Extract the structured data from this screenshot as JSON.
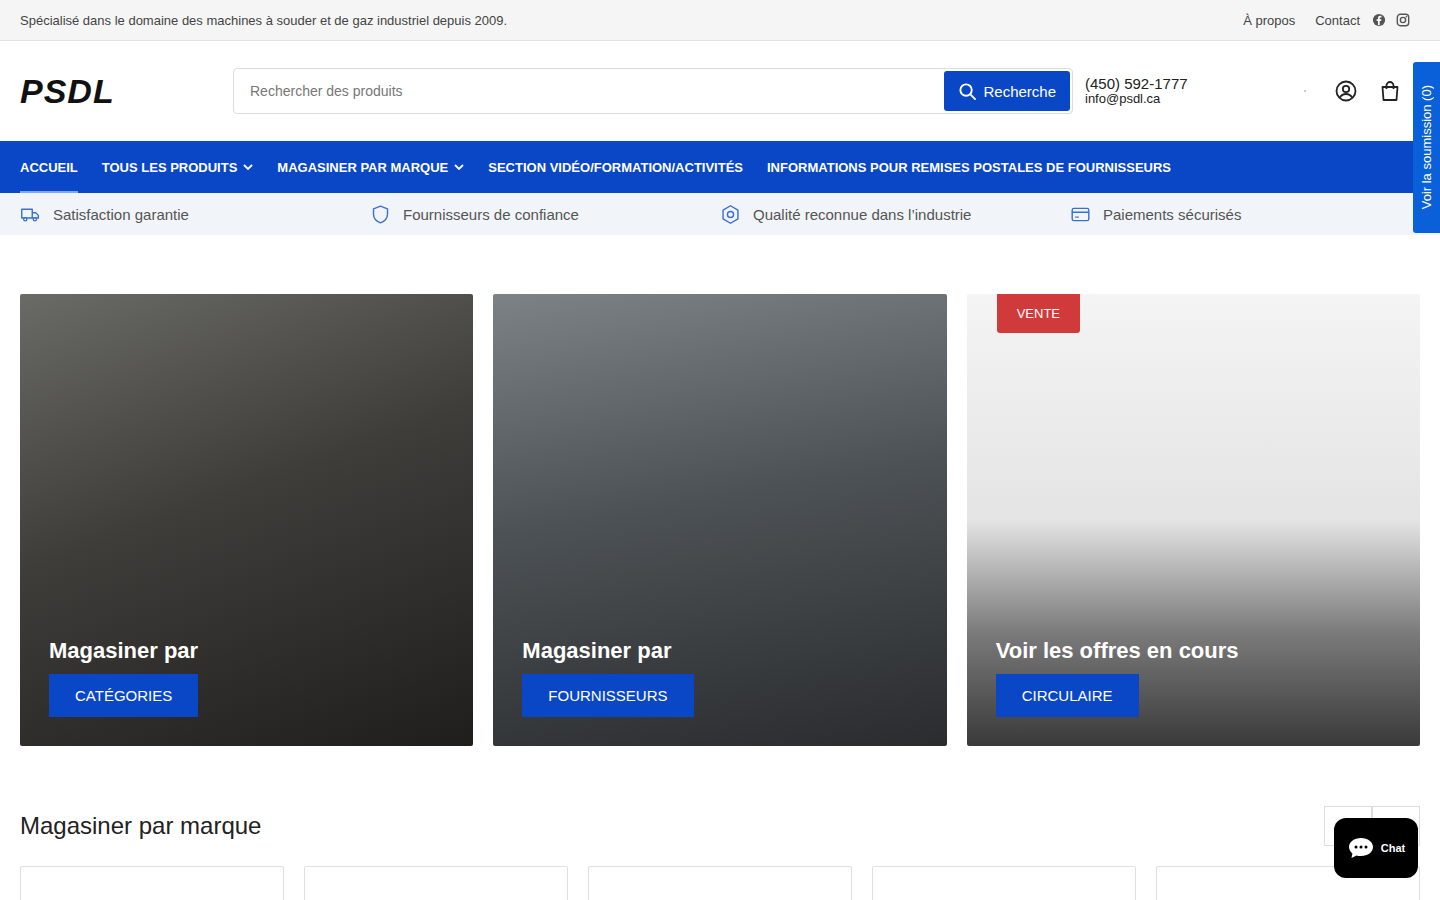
{
  "announcement": {
    "text": "Spécialisé dans le domaine des machines à souder et de gaz industriel depuis 2009.",
    "links": [
      "À propos",
      "Contact"
    ]
  },
  "header": {
    "logo": "PSDL",
    "search": {
      "placeholder": "Rechercher des produits",
      "button": "Recherche"
    },
    "phone": "(450) 592-1777",
    "email": "info@psdl.ca"
  },
  "nav": [
    {
      "label": "ACCUEIL",
      "selected": true,
      "dropdown": false
    },
    {
      "label": "TOUS LES PRODUITS",
      "selected": false,
      "dropdown": true
    },
    {
      "label": "MAGASINER PAR MARQUE",
      "selected": false,
      "dropdown": true
    },
    {
      "label": "SECTION VIDÉO/FORMATION/ACTIVITÉS",
      "selected": false,
      "dropdown": false
    },
    {
      "label": "INFORMATIONS POUR REMISES POSTALES DE FOURNISSEURS",
      "selected": false,
      "dropdown": false
    }
  ],
  "features": [
    {
      "label": "Satisfaction garantie",
      "kind": "truck"
    },
    {
      "label": "Fournisseurs de confiance",
      "kind": "shield"
    },
    {
      "label": "Qualité reconnue dans l’industrie",
      "kind": "badge"
    },
    {
      "label": "Paiements sécurisés",
      "kind": "card"
    }
  ],
  "quote_tab": "Voir la soumission (0)",
  "hero_cards": [
    {
      "title": "Magasiner par",
      "button": "CATÉGORIES",
      "kind": "dark"
    },
    {
      "title": "Magasiner par",
      "button": "FOURNISSEURS",
      "kind": "grey"
    },
    {
      "title": "Voir les offres en cours",
      "button": "CIRCULAIRE",
      "kind": "light",
      "badge": "VENTE"
    }
  ],
  "brands": {
    "title": "Magasiner par marque"
  },
  "chat": {
    "label": "Chat"
  }
}
